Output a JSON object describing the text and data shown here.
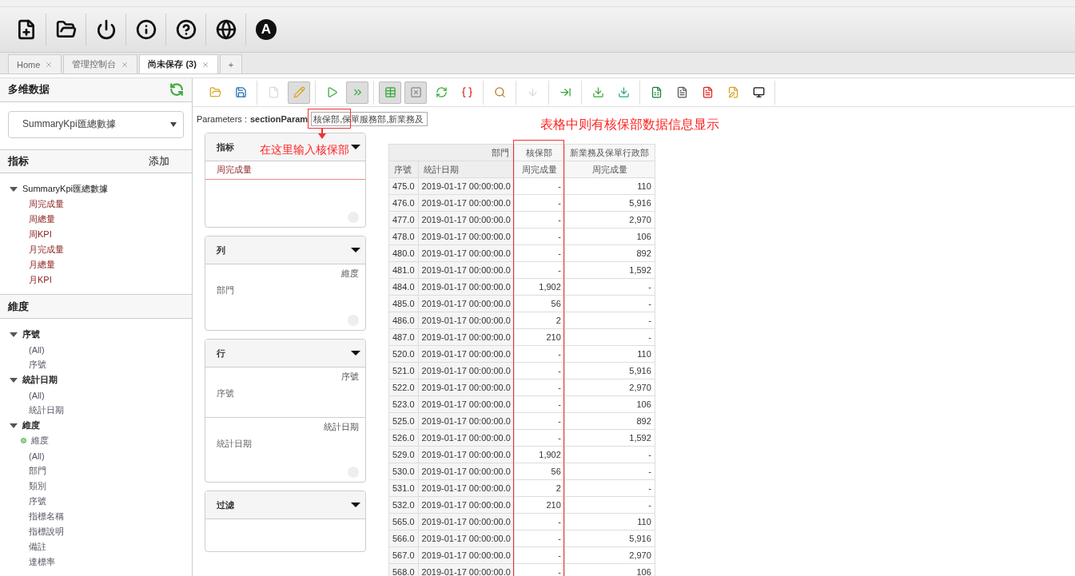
{
  "top_toolbar": [
    {
      "kind": "new"
    },
    {
      "kind": "open"
    },
    {
      "kind": "power"
    },
    {
      "kind": "info"
    },
    {
      "kind": "help"
    },
    {
      "kind": "language"
    },
    {
      "kind": "letter",
      "label": "A"
    }
  ],
  "tabs": [
    {
      "kind": "page",
      "label": "Home",
      "selected": false
    },
    {
      "kind": "page",
      "label": "管理控制台",
      "selected": false
    },
    {
      "kind": "page",
      "label": "尚未保存 (3)",
      "selected": true
    },
    {
      "kind": "add",
      "label": "+",
      "selected": false
    }
  ],
  "sidebar": {
    "title": "多维数据",
    "cube_select": "SummaryKpi匯總數據",
    "measures": {
      "title": "指标",
      "add_label": "添加",
      "tree": [
        {
          "label": "SummaryKpi匯總數據",
          "expanded": true,
          "children": [
            {
              "label": "周完成量"
            },
            {
              "label": "周總量"
            },
            {
              "label": "周KPI"
            },
            {
              "label": "月完成量"
            },
            {
              "label": "月總量"
            },
            {
              "label": "月KPI"
            }
          ]
        }
      ]
    },
    "dimensions": {
      "title": "維度",
      "tree": [
        {
          "label": "序號",
          "expanded": true,
          "children": [
            {
              "label": "(All)",
              "kind": "level"
            },
            {
              "label": "序號",
              "kind": "level"
            }
          ]
        },
        {
          "label": "統計日期",
          "expanded": true,
          "children": [
            {
              "label": "(All)",
              "kind": "level"
            },
            {
              "label": "統計日期",
              "kind": "level"
            }
          ]
        },
        {
          "label": "維度",
          "expanded": true,
          "children": [
            {
              "label": "維度",
              "kind": "hierarchy"
            },
            {
              "label": "(All)",
              "kind": "level"
            },
            {
              "label": "部門",
              "kind": "level"
            },
            {
              "label": "類別",
              "kind": "level"
            },
            {
              "label": "序號",
              "kind": "level"
            },
            {
              "label": "指標名稱",
              "kind": "level"
            },
            {
              "label": "指標說明",
              "kind": "level"
            },
            {
              "label": "備註",
              "kind": "level"
            },
            {
              "label": "達標率",
              "kind": "level"
            }
          ]
        }
      ]
    }
  },
  "toolbar": [
    {
      "kind": "open",
      "pressed": false,
      "disabled": false
    },
    {
      "kind": "save",
      "pressed": false,
      "disabled": false
    },
    {
      "kind": "new",
      "pressed": false,
      "disabled": true
    },
    {
      "kind": "edit",
      "pressed": true,
      "disabled": false
    },
    {
      "kind": "run",
      "pressed": false,
      "disabled": false
    },
    {
      "kind": "auto-run",
      "pressed": true,
      "disabled": false
    },
    {
      "kind": "table",
      "pressed": true,
      "disabled": false
    },
    {
      "kind": "hide-empty",
      "pressed": true,
      "disabled": false
    },
    {
      "kind": "swap",
      "pressed": false,
      "disabled": false
    },
    {
      "kind": "mdx",
      "pressed": false,
      "disabled": false
    },
    {
      "kind": "search",
      "pressed": false,
      "disabled": false
    },
    {
      "kind": "drill",
      "pressed": false,
      "disabled": true
    },
    {
      "kind": "drill-across",
      "pressed": false,
      "disabled": false
    },
    {
      "kind": "export",
      "pressed": false,
      "disabled": false
    },
    {
      "kind": "export-csv",
      "pressed": false,
      "disabled": false
    },
    {
      "kind": "excel",
      "pressed": false,
      "disabled": false
    },
    {
      "kind": "text",
      "pressed": false,
      "disabled": false
    },
    {
      "kind": "pdf",
      "pressed": false,
      "disabled": false
    },
    {
      "kind": "report",
      "pressed": false,
      "disabled": false
    },
    {
      "kind": "screen",
      "pressed": false,
      "disabled": false
    }
  ],
  "parameters": {
    "label": "Parameters :",
    "name": "sectionParam",
    "value": "核保部,保單服務部,新業務及"
  },
  "panels": [
    {
      "title": "指标",
      "fields": [
        {
          "kind": "measure",
          "label": "周完成量"
        }
      ]
    },
    {
      "title": "列",
      "fields": [
        {
          "kind": "dimension",
          "hierarchy": "維度",
          "level": "部門"
        }
      ]
    },
    {
      "title": "行",
      "fields": [
        {
          "kind": "dimension",
          "hierarchy": "序號",
          "level": "序號"
        },
        {
          "kind": "dimension",
          "hierarchy": "統計日期",
          "level": "統計日期"
        }
      ]
    },
    {
      "title": "过滤"
    }
  ],
  "table": {
    "column_groups": [
      {
        "kind": "dimension",
        "label": "部門"
      },
      {
        "kind": "member",
        "label": "核保部"
      },
      {
        "kind": "member",
        "label": "新業務及保單行政部"
      }
    ],
    "columns": [
      "序號",
      "統計日期",
      "周完成量",
      "周完成量"
    ],
    "rows": [
      [
        "475.0",
        "2019-01-17 00:00:00.0",
        "-",
        "110"
      ],
      [
        "476.0",
        "2019-01-17 00:00:00.0",
        "-",
        "5,916"
      ],
      [
        "477.0",
        "2019-01-17 00:00:00.0",
        "-",
        "2,970"
      ],
      [
        "478.0",
        "2019-01-17 00:00:00.0",
        "-",
        "106"
      ],
      [
        "480.0",
        "2019-01-17 00:00:00.0",
        "-",
        "892"
      ],
      [
        "481.0",
        "2019-01-17 00:00:00.0",
        "-",
        "1,592"
      ],
      [
        "484.0",
        "2019-01-17 00:00:00.0",
        "1,902",
        "-"
      ],
      [
        "485.0",
        "2019-01-17 00:00:00.0",
        "56",
        "-"
      ],
      [
        "486.0",
        "2019-01-17 00:00:00.0",
        "2",
        "-"
      ],
      [
        "487.0",
        "2019-01-17 00:00:00.0",
        "210",
        "-"
      ],
      [
        "520.0",
        "2019-01-17 00:00:00.0",
        "-",
        "110"
      ],
      [
        "521.0",
        "2019-01-17 00:00:00.0",
        "-",
        "5,916"
      ],
      [
        "522.0",
        "2019-01-17 00:00:00.0",
        "-",
        "2,970"
      ],
      [
        "523.0",
        "2019-01-17 00:00:00.0",
        "-",
        "106"
      ],
      [
        "525.0",
        "2019-01-17 00:00:00.0",
        "-",
        "892"
      ],
      [
        "526.0",
        "2019-01-17 00:00:00.0",
        "-",
        "1,592"
      ],
      [
        "529.0",
        "2019-01-17 00:00:00.0",
        "1,902",
        "-"
      ],
      [
        "530.0",
        "2019-01-17 00:00:00.0",
        "56",
        "-"
      ],
      [
        "531.0",
        "2019-01-17 00:00:00.0",
        "2",
        "-"
      ],
      [
        "532.0",
        "2019-01-17 00:00:00.0",
        "210",
        "-"
      ],
      [
        "565.0",
        "2019-01-17 00:00:00.0",
        "-",
        "110"
      ],
      [
        "566.0",
        "2019-01-17 00:00:00.0",
        "-",
        "5,916"
      ],
      [
        "567.0",
        "2019-01-17 00:00:00.0",
        "-",
        "2,970"
      ],
      [
        "568.0",
        "2019-01-17 00:00:00.0",
        "-",
        "106"
      ]
    ]
  },
  "annotations": [
    {
      "kind": "input-note",
      "text": "在这里输入核保部"
    },
    {
      "kind": "table-note",
      "text": "表格中则有核保部数据信息显示"
    }
  ]
}
